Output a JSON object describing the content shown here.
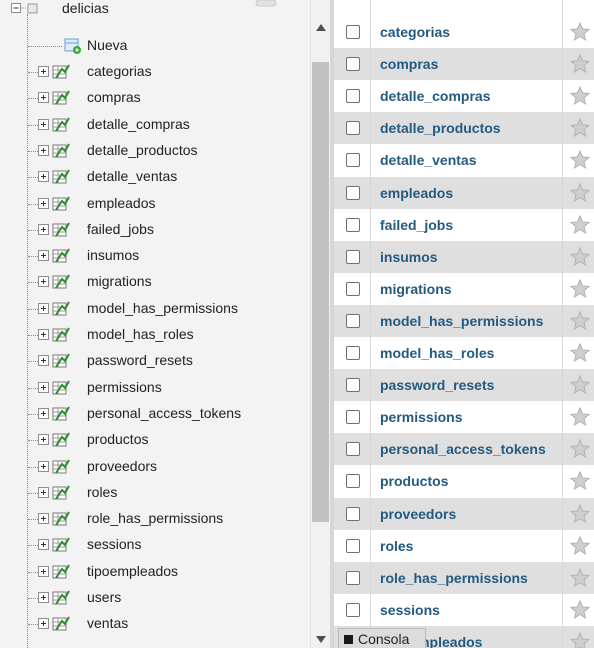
{
  "nav": {
    "database": "delicias",
    "new_item": "Nueva",
    "tables": [
      "categorias",
      "compras",
      "detalle_compras",
      "detalle_productos",
      "detalle_ventas",
      "empleados",
      "failed_jobs",
      "insumos",
      "migrations",
      "model_has_permissions",
      "model_has_roles",
      "password_resets",
      "permissions",
      "personal_access_tokens",
      "productos",
      "proveedors",
      "roles",
      "role_has_permissions",
      "sessions",
      "tipoempleados",
      "users",
      "ventas"
    ]
  },
  "main": {
    "rows": [
      "categorias",
      "compras",
      "detalle_compras",
      "detalle_productos",
      "detalle_ventas",
      "empleados",
      "failed_jobs",
      "insumos",
      "migrations",
      "model_has_permissions",
      "model_has_roles",
      "password_resets",
      "permissions",
      "personal_access_tokens",
      "productos",
      "proveedors",
      "roles",
      "role_has_permissions",
      "sessions",
      "tipoempleados"
    ],
    "partial_last_row": "npleados"
  },
  "console": {
    "label": "Consola"
  },
  "colors": {
    "link": "#235a81",
    "row_alt": "#dfdfdf",
    "nav_bg": "#f3f3f3",
    "star": "#c4c4c4"
  },
  "icons": {
    "tree_expander": "plus-box-icon",
    "table": "table-icon",
    "new": "new-table-icon",
    "favorite": "star-icon"
  }
}
